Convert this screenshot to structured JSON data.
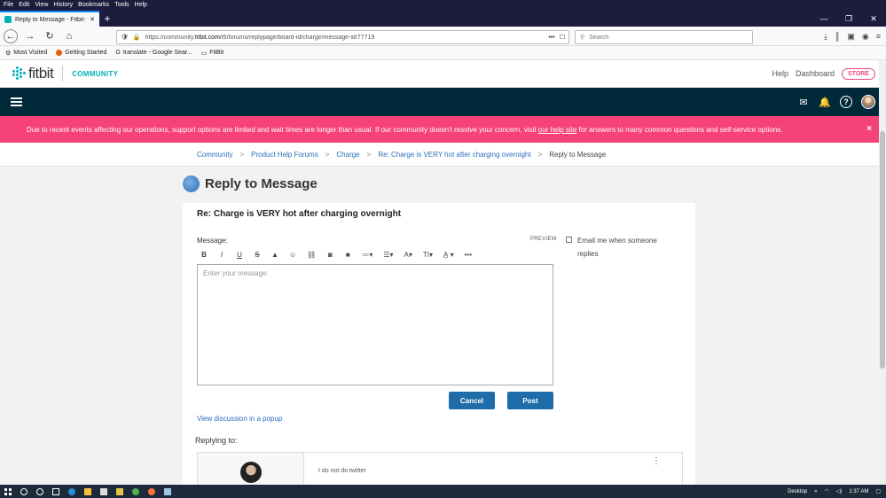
{
  "browser": {
    "menu": [
      "File",
      "Edit",
      "View",
      "History",
      "Bookmarks",
      "Tools",
      "Help"
    ],
    "tab_title": "Reply to Message - Fitbit Comm",
    "url_prefix": "https://community.",
    "url_domain": "fitbit.com",
    "url_path": "/t5/forums/replypage/board-id/charge/message-id/77719",
    "search_placeholder": "Search",
    "bookmarks": [
      "Most Visited",
      "Getting Started",
      "translate - Google Sear...",
      "FitBit"
    ]
  },
  "site": {
    "logo_text": "fitbit",
    "community_label": "COMMUNITY",
    "header_links": {
      "help": "Help",
      "dashboard": "Dashboard",
      "store": "STORE"
    }
  },
  "alert": {
    "text_before": "Due to recent events affecting our operations, support options are limited and wait times are longer than usual. If our community doesn't resolve your concern, visit ",
    "link": "our help site",
    "text_after": " for answers to many common questions and self-service options.",
    "close": "×"
  },
  "breadcrumb": {
    "items": [
      "Community",
      "Product Help Forums",
      "Charge",
      "Re: Charge is VERY hot after charging overnight"
    ],
    "current": "Reply to Message",
    "separator": ">"
  },
  "page": {
    "title": "Reply to Message",
    "subject": "Re: Charge is VERY hot after charging overnight"
  },
  "editor": {
    "message_label": "Message:",
    "preview": "PREVIEW",
    "placeholder": "Enter your message:",
    "cancel": "Cancel",
    "post": "Post",
    "popup_link": "View discussion in a popup",
    "email_option": "Email me when someone replies"
  },
  "replying": {
    "label": "Replying to:",
    "text": "I do not do twitter"
  },
  "taskbar": {
    "desktop": "Desktop",
    "time": "1:37 AM"
  },
  "colors": {
    "teal_bar": "#002a3a",
    "alert": "#f5427a",
    "accent": "#00b0b9",
    "button": "#1e6ca8",
    "link": "#2a6ebb"
  }
}
